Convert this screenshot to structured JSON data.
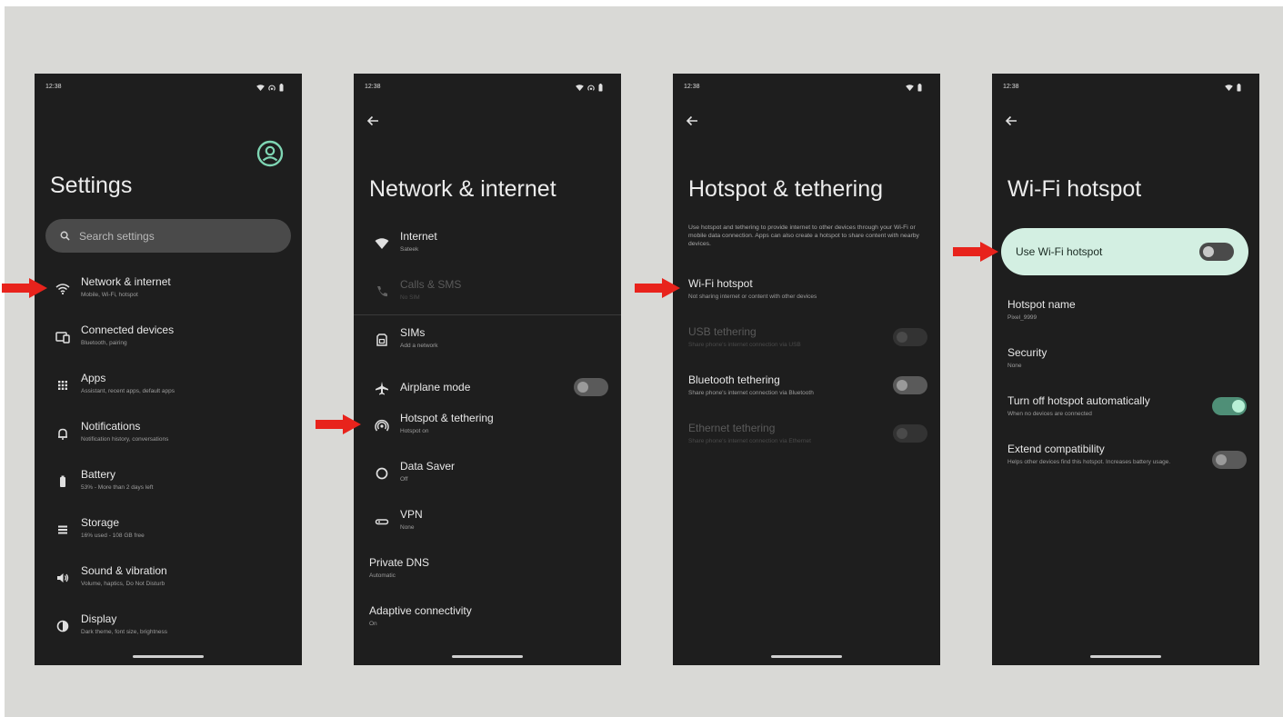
{
  "status": {
    "time": "12:38"
  },
  "screen1": {
    "title": "Settings",
    "search_placeholder": "Search settings",
    "items": [
      {
        "title": "Network & internet",
        "subtitle": "Mobile, Wi-Fi, hotspot",
        "icon": "wifi-icon"
      },
      {
        "title": "Connected devices",
        "subtitle": "Bluetooth, pairing",
        "icon": "devices-icon"
      },
      {
        "title": "Apps",
        "subtitle": "Assistant, recent apps, default apps",
        "icon": "apps-grid-icon"
      },
      {
        "title": "Notifications",
        "subtitle": "Notification history, conversations",
        "icon": "bell-icon"
      },
      {
        "title": "Battery",
        "subtitle": "53% - More than 2 days left",
        "icon": "battery-icon"
      },
      {
        "title": "Storage",
        "subtitle": "16% used - 108 GB free",
        "icon": "storage-icon"
      },
      {
        "title": "Sound & vibration",
        "subtitle": "Volume, haptics, Do Not Disturb",
        "icon": "volume-icon"
      },
      {
        "title": "Display",
        "subtitle": "Dark theme, font size, brightness",
        "icon": "display-icon"
      }
    ]
  },
  "screen2": {
    "title": "Network & internet",
    "items": [
      {
        "title": "Internet",
        "subtitle": "Sateek"
      },
      {
        "title": "Calls & SMS",
        "subtitle": "No SIM"
      },
      {
        "title": "SIMs",
        "subtitle": "Add a network"
      },
      {
        "title": "Airplane mode",
        "subtitle": ""
      },
      {
        "title": "Hotspot & tethering",
        "subtitle": "Hotspot on"
      },
      {
        "title": "Data Saver",
        "subtitle": "Off"
      },
      {
        "title": "VPN",
        "subtitle": "None"
      },
      {
        "title": "Private DNS",
        "subtitle": "Automatic"
      },
      {
        "title": "Adaptive connectivity",
        "subtitle": "On"
      }
    ]
  },
  "screen3": {
    "title": "Hotspot & tethering",
    "description": "Use hotspot and tethering to provide internet to other devices through your Wi-Fi or mobile data connection. Apps can also create a hotspot to share content with nearby devices.",
    "items": [
      {
        "title": "Wi-Fi hotspot",
        "subtitle": "Not sharing internet or content with other devices"
      },
      {
        "title": "USB tethering",
        "subtitle": "Share phone's internet connection via USB"
      },
      {
        "title": "Bluetooth tethering",
        "subtitle": "Share phone's internet connection via Bluetooth"
      },
      {
        "title": "Ethernet tethering",
        "subtitle": "Share phone's internet connection via Ethernet"
      }
    ]
  },
  "screen4": {
    "title": "Wi-Fi hotspot",
    "use_hotspot": "Use Wi-Fi hotspot",
    "items": [
      {
        "title": "Hotspot name",
        "subtitle": "Pixel_9999"
      },
      {
        "title": "Security",
        "subtitle": "None"
      },
      {
        "title": "Turn off hotspot automatically",
        "subtitle": "When no devices are connected"
      },
      {
        "title": "Extend compatibility",
        "subtitle": "Helps other devices find this hotspot. Increases battery usage."
      }
    ]
  },
  "colors": {
    "phone_bg": "#1e1e1e",
    "accent": "#7fd6b4",
    "card": "#d3efe2",
    "arrow": "#e8231c",
    "stage": "#d9d9d6"
  }
}
